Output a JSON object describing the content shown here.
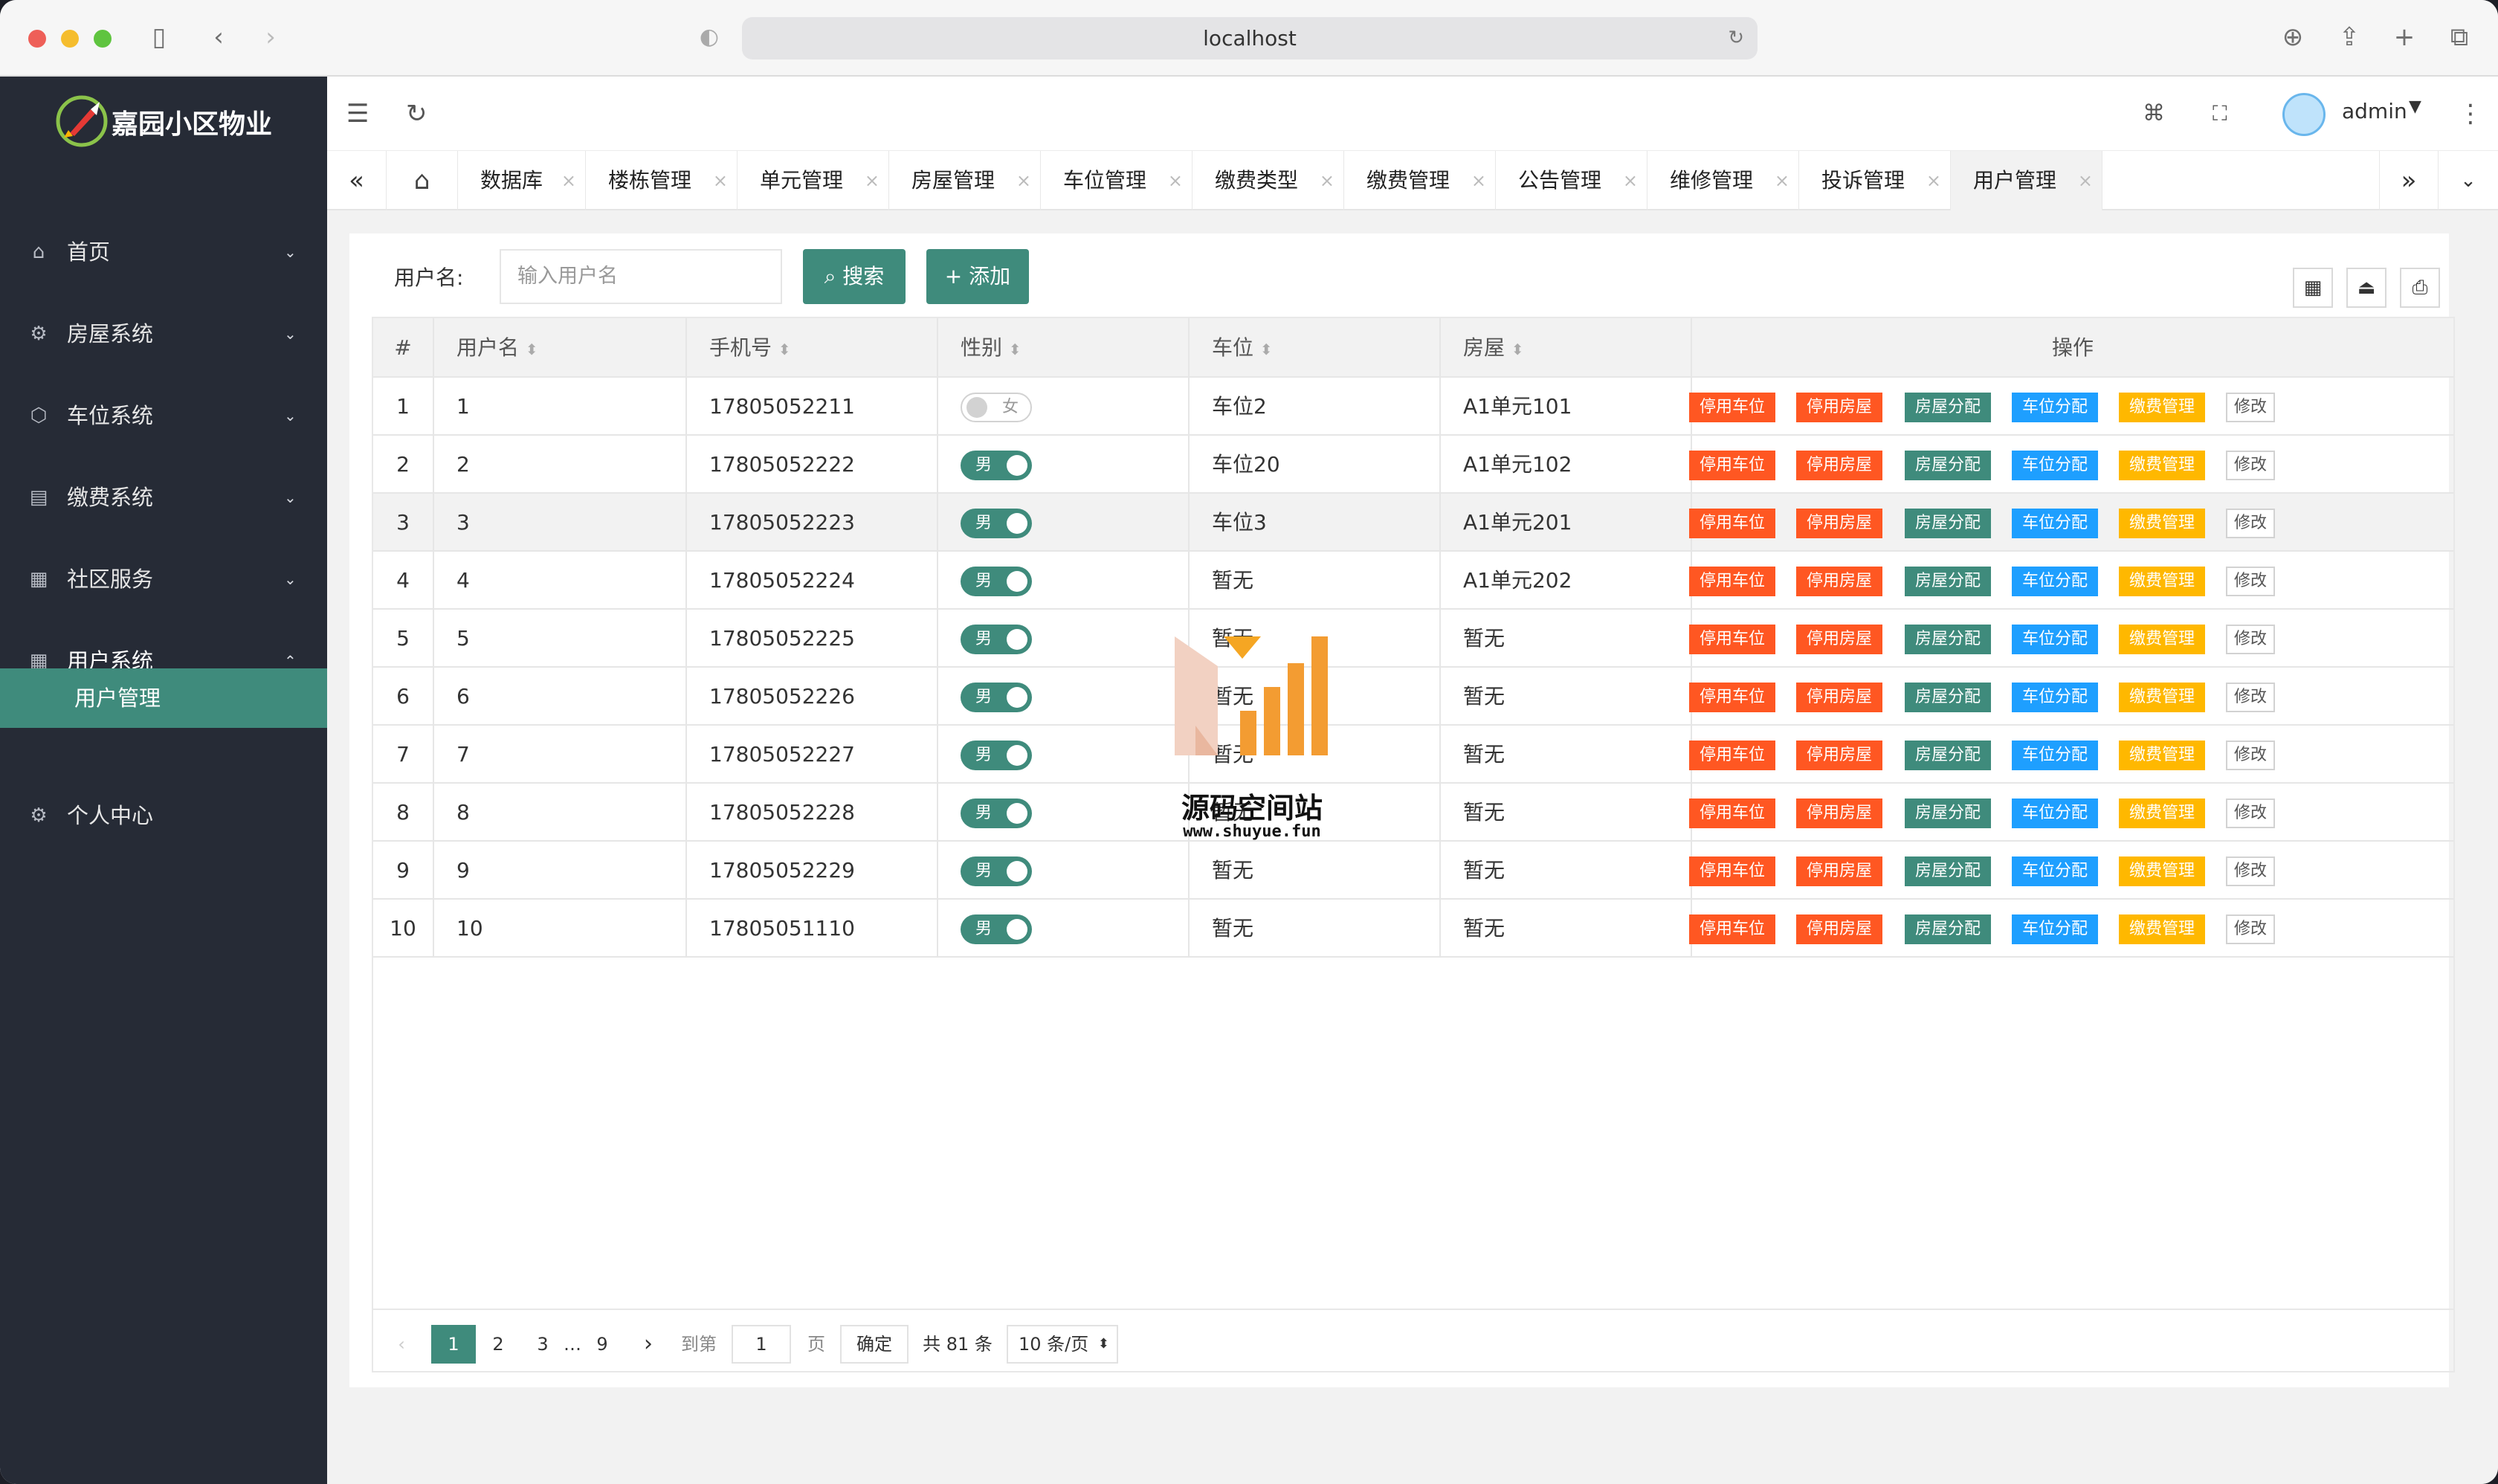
{
  "browser": {
    "url": "localhost"
  },
  "app": {
    "brand": "嘉园小区物业",
    "user": "admin"
  },
  "sidebar": {
    "items": [
      {
        "label": "首页",
        "icon": "home-icon"
      },
      {
        "label": "房屋系统",
        "icon": "gear-icon"
      },
      {
        "label": "车位系统",
        "icon": "cube-icon"
      },
      {
        "label": "缴费系统",
        "icon": "receipt-icon"
      },
      {
        "label": "社区服务",
        "icon": "grid-icon"
      },
      {
        "label": "用户系统",
        "icon": "apps-icon"
      },
      {
        "label": "个人中心",
        "icon": "settings-icon"
      }
    ],
    "subitem": "用户管理"
  },
  "tabs": [
    "数据库",
    "楼栋管理",
    "单元管理",
    "房屋管理",
    "车位管理",
    "缴费类型",
    "缴费管理",
    "公告管理",
    "维修管理",
    "投诉管理",
    "用户管理"
  ],
  "search": {
    "label": "用户名:",
    "placeholder": "输入用户名",
    "search_btn": "搜索",
    "add_btn": "添加"
  },
  "table": {
    "headers": [
      "#",
      "用户名",
      "手机号",
      "性别",
      "车位",
      "房屋",
      "操作"
    ],
    "rows": [
      [
        "1",
        "1",
        "17805052211",
        "女",
        "车位2",
        "A1单元101"
      ],
      [
        "2",
        "2",
        "17805052222",
        "男",
        "车位20",
        "A1单元102"
      ],
      [
        "3",
        "3",
        "17805052223",
        "男",
        "车位3",
        "A1单元201"
      ],
      [
        "4",
        "4",
        "17805052224",
        "男",
        "暂无",
        "A1单元202"
      ],
      [
        "5",
        "5",
        "17805052225",
        "男",
        "暂无",
        "暂无"
      ],
      [
        "6",
        "6",
        "17805052226",
        "男",
        "暂无",
        "暂无"
      ],
      [
        "7",
        "7",
        "17805052227",
        "男",
        "暂无",
        "暂无"
      ],
      [
        "8",
        "8",
        "17805052228",
        "男",
        "暂无",
        "暂无"
      ],
      [
        "9",
        "9",
        "17805052229",
        "男",
        "暂无",
        "暂无"
      ],
      [
        "10",
        "10",
        "17805051110",
        "男",
        "暂无",
        "暂无"
      ]
    ],
    "actions": [
      "停用车位",
      "停用房屋",
      "房屋分配",
      "车位分配",
      "缴费管理",
      "修改"
    ]
  },
  "pager": {
    "pages": [
      "1",
      "2",
      "3",
      "…",
      "9"
    ],
    "goto": "到第",
    "page_input": "1",
    "page_unit": "页",
    "confirm": "确定",
    "total": "共 81 条",
    "per_page": "10 条/页"
  },
  "watermark": {
    "title": "源码空间站",
    "url": "www.shuyue.fun"
  }
}
